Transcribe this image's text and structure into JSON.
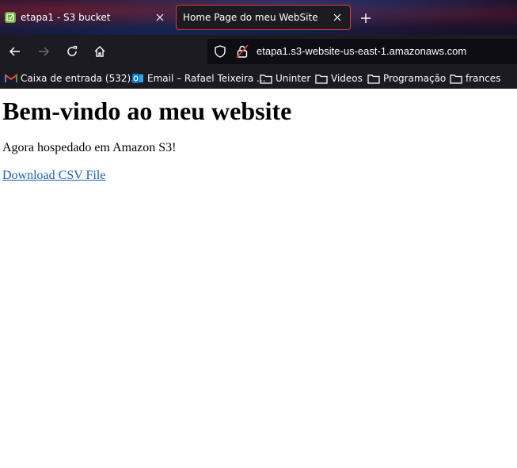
{
  "browser": {
    "tabs": [
      {
        "label": "etapa1 - S3 bucket",
        "active": false
      },
      {
        "label": "Home Page do meu WebSite",
        "active": true
      }
    ],
    "url": "etapa1.s3-website-us-east-1.amazonaws.com",
    "bookmarks": [
      {
        "label": "Caixa de entrada (532)...",
        "icon": "gmail-icon"
      },
      {
        "label": "Email – Rafael Teixeira ...",
        "icon": "outlook-icon"
      },
      {
        "label": "Uninter",
        "icon": "folder-icon"
      },
      {
        "label": "Videos",
        "icon": "folder-icon"
      },
      {
        "label": "Programação",
        "icon": "folder-icon"
      },
      {
        "label": "frances",
        "icon": "folder-icon"
      }
    ],
    "colors": {
      "active_tab_border": "#e0383e",
      "toolbar": "#1c1b22"
    }
  },
  "page": {
    "heading": "Bem-vindo ao meu website",
    "subtitle": "Agora hospedado em Amazon S3!",
    "download_link": "Download CSV File"
  }
}
